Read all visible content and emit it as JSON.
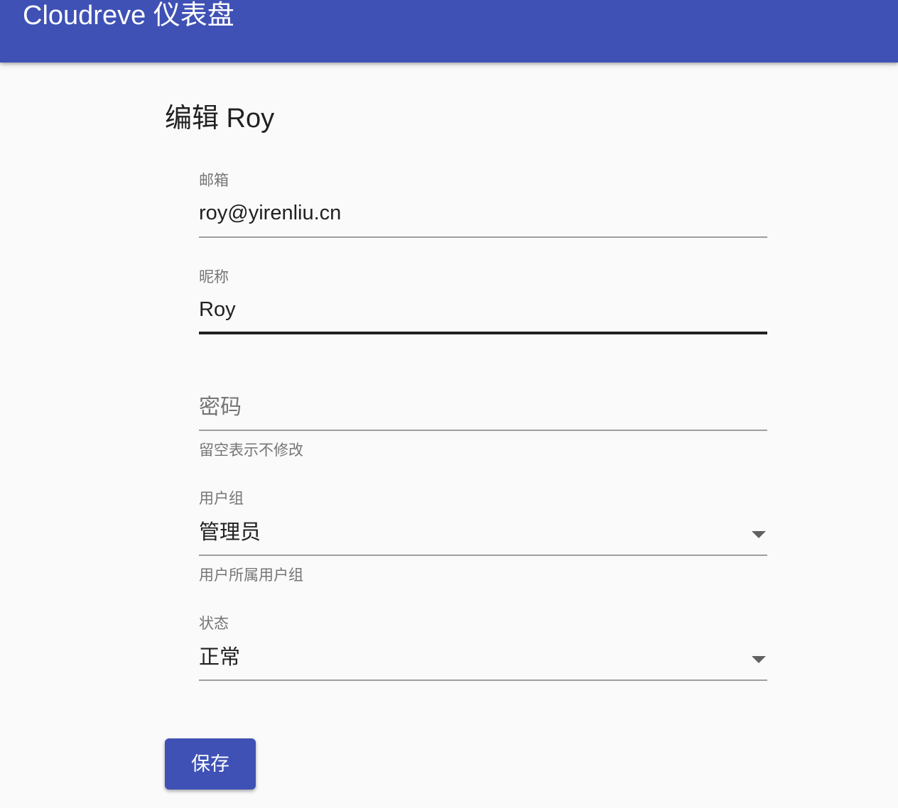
{
  "appbar": {
    "title": "Cloudreve 仪表盘",
    "color": "#3f51b5"
  },
  "page": {
    "title": "编辑 Roy"
  },
  "form": {
    "email": {
      "label": "邮箱",
      "value": "roy@yirenliu.cn"
    },
    "nickname": {
      "label": "昵称",
      "value": "Roy"
    },
    "password": {
      "label": "密码",
      "value": "",
      "helper": "留空表示不修改"
    },
    "group": {
      "label": "用户组",
      "value": "管理员",
      "helper": "用户所属用户组",
      "icon": "arrow-drop-down-icon"
    },
    "status": {
      "label": "状态",
      "value": "正常",
      "icon": "arrow-drop-down-icon"
    }
  },
  "actions": {
    "save_label": "保存"
  }
}
